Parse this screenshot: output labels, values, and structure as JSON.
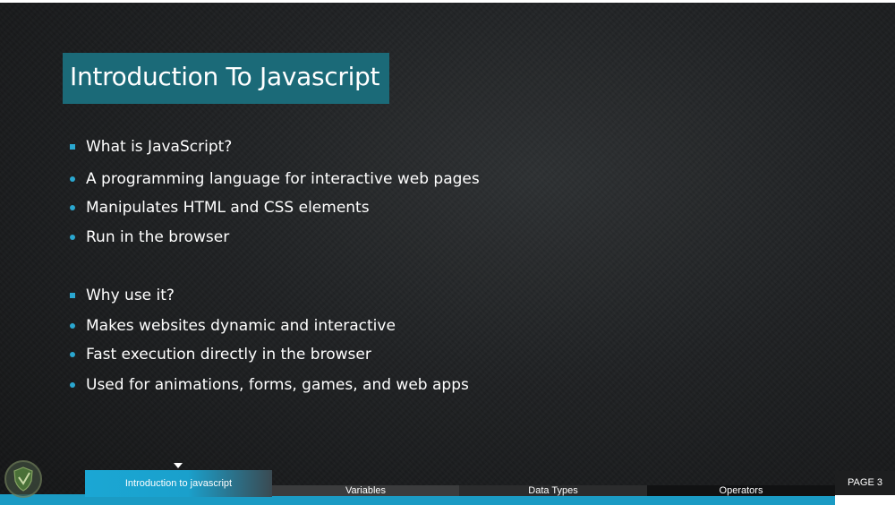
{
  "slide": {
    "title": "Introduction To Javascript",
    "bullets": [
      {
        "text": "What is JavaScript?",
        "marker": "square"
      },
      {
        "text": "A programming language for interactive web pages",
        "marker": "dot"
      },
      {
        "text": "Manipulates HTML and CSS elements",
        "marker": "dot"
      },
      {
        "text": "Run in the browser",
        "marker": "dot"
      },
      {
        "text": "Why use it?",
        "marker": "square"
      },
      {
        "text": "Makes websites dynamic and interactive",
        "marker": "dot"
      },
      {
        "text": "Fast execution directly in the browser",
        "marker": "dot"
      },
      {
        "text": "Used for animations, forms, games, and web apps",
        "marker": "dot"
      }
    ]
  },
  "nav": {
    "tabs": [
      {
        "label": "Introduction to javascript",
        "active": true
      },
      {
        "label": "Variables",
        "active": false
      },
      {
        "label": "Data Types",
        "active": false
      },
      {
        "label": "Operators",
        "active": false
      }
    ],
    "page_label": "PAGE 3"
  },
  "colors": {
    "accent": "#1b9bc4",
    "title_bg": "#1b6a78",
    "bullet": "#2aa7d0",
    "background": "#1f2123"
  },
  "icons": {
    "logo": "shield-logo-icon",
    "tab_indicator": "triangle-down-icon"
  }
}
